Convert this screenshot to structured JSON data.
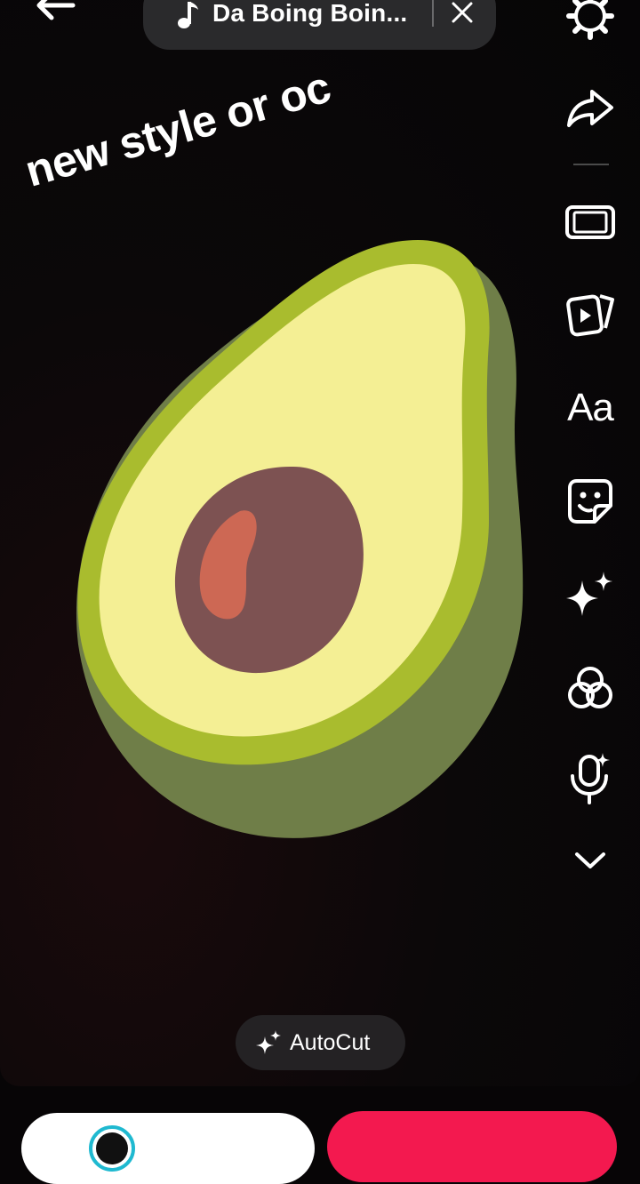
{
  "header": {
    "back_icon": "back-arrow-icon",
    "music": {
      "icon": "music-note-icon",
      "title": "Da Boing Boin...",
      "close_icon": "close-icon"
    }
  },
  "canvas": {
    "overlay_text": "new style or oc",
    "image": "avocado-half-illustration"
  },
  "toolbar": {
    "items": [
      {
        "icon": "settings-gear-icon"
      },
      {
        "icon": "share-arrow-icon"
      },
      {
        "icon": "aspect-ratio-icon"
      },
      {
        "icon": "templates-icon"
      },
      {
        "icon": "text-icon",
        "label": "Aa"
      },
      {
        "icon": "sticker-icon"
      },
      {
        "icon": "effects-sparkle-icon"
      },
      {
        "icon": "filters-icon"
      },
      {
        "icon": "voice-effects-mic-icon"
      },
      {
        "icon": "chevron-down-icon"
      }
    ]
  },
  "autocut": {
    "icon": "sparkle-icon",
    "label": "AutoCut"
  },
  "bottom_bar": {
    "left_button_icon": "story-avatar-icon",
    "right_button_color": "#f3194f"
  },
  "colors": {
    "avocado_skin": "#6f7e48",
    "avocado_rim": "#a9bc2e",
    "avocado_flesh": "#f4ef94",
    "avocado_pit": "#7d5252",
    "avocado_highlight": "#cd6854",
    "accent": "#f3194f"
  }
}
